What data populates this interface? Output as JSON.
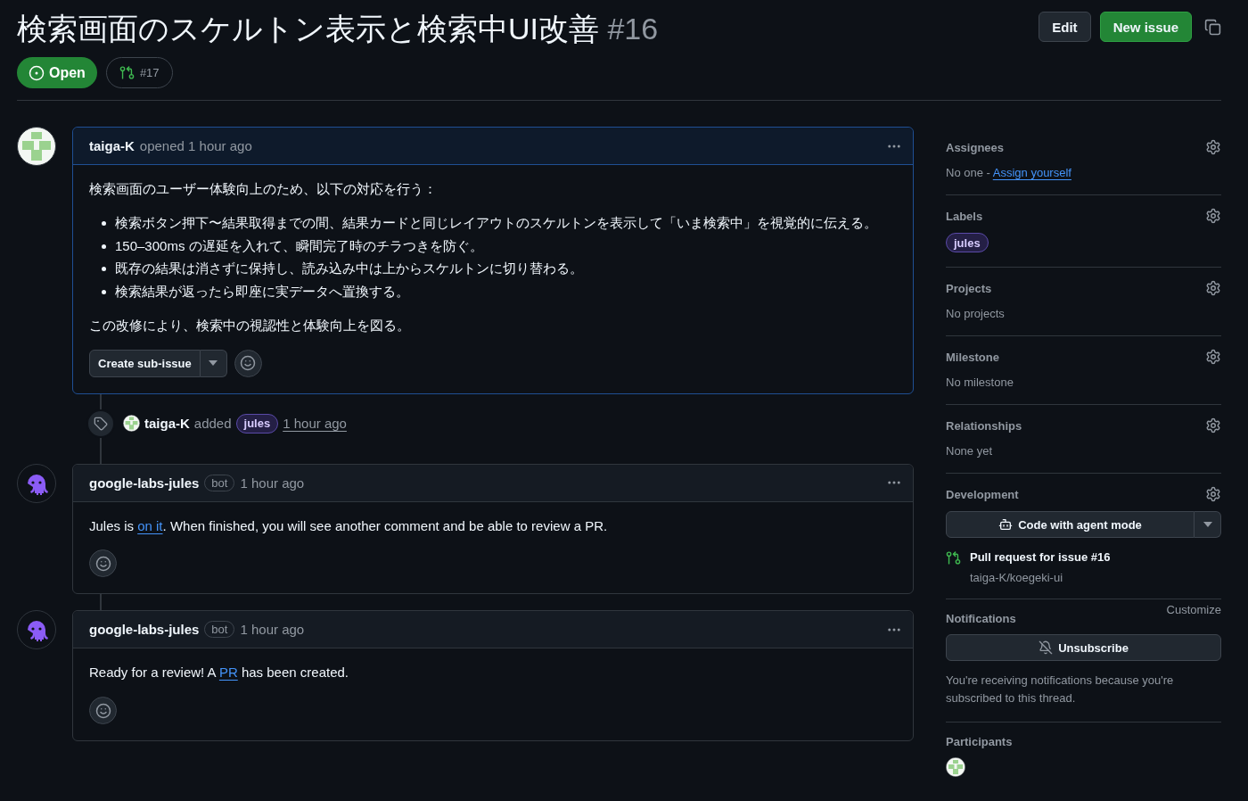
{
  "header": {
    "title": "検索画面のスケルトン表示と検索中UI改善",
    "number": "#16",
    "state": {
      "label": "Open",
      "kind": "open"
    },
    "linked_pr": "#17",
    "actions": [
      {
        "label": "Edit",
        "kind": "default"
      },
      {
        "label": "New issue",
        "kind": "primary"
      }
    ]
  },
  "timeline": [
    {
      "kind": "comment",
      "highlighted": true,
      "avatar": {
        "kind": "identicon"
      },
      "author": "taiga-K",
      "meta": "opened 1 hour ago",
      "body": [
        {
          "kind": "paragraph",
          "segments": [
            {
              "text": "検索画面のユーザー体験向上のため、以下の対応を行う："
            }
          ]
        },
        {
          "kind": "list",
          "items": [
            "検索ボタン押下〜結果取得までの間、結果カードと同じレイアウトのスケルトンを表示して「いま検索中」を視覚的に伝える。",
            "150–300ms の遅延を入れて、瞬間完了時のチラつきを防ぐ。",
            "既存の結果は消さずに保持し、読み込み中は上からスケルトンに切り替わる。",
            "検索結果が返ったら即座に実データへ置換する。"
          ]
        },
        {
          "kind": "paragraph",
          "segments": [
            {
              "text": "この改修により、検索中の視認性と体験向上を図る。"
            }
          ]
        }
      ],
      "footer_button": "Create sub-issue"
    },
    {
      "kind": "event",
      "avatar": {
        "kind": "identicon"
      },
      "actor": "taiga-K",
      "action": "added",
      "label": "jules",
      "time": "1 hour ago"
    },
    {
      "kind": "comment",
      "highlighted": false,
      "avatar": {
        "kind": "octopus"
      },
      "author": "google-labs-jules",
      "badge": "bot",
      "meta": "1 hour ago",
      "body": [
        {
          "kind": "paragraph",
          "segments": [
            {
              "text": "Jules is "
            },
            {
              "link": "on it"
            },
            {
              "text": ". When finished, you will see another comment and be able to review a PR."
            }
          ]
        }
      ]
    },
    {
      "kind": "comment",
      "highlighted": false,
      "avatar": {
        "kind": "octopus"
      },
      "author": "google-labs-jules",
      "badge": "bot",
      "meta": "1 hour ago",
      "body": [
        {
          "kind": "paragraph",
          "segments": [
            {
              "text": "Ready for a review! A "
            },
            {
              "link": "PR"
            },
            {
              "text": " has been created."
            }
          ]
        }
      ]
    }
  ],
  "sidebar": [
    {
      "kind": "text",
      "title": "Assignees",
      "settings": true,
      "segments": [
        {
          "text": "No one - "
        },
        {
          "link": "Assign yourself"
        }
      ]
    },
    {
      "kind": "labels",
      "title": "Labels",
      "settings": true,
      "labels": [
        "jules"
      ]
    },
    {
      "kind": "text",
      "title": "Projects",
      "settings": true,
      "segments": [
        {
          "text": "No projects"
        }
      ]
    },
    {
      "kind": "text",
      "title": "Milestone",
      "settings": true,
      "segments": [
        {
          "text": "No milestone"
        }
      ]
    },
    {
      "kind": "text",
      "title": "Relationships",
      "settings": true,
      "segments": [
        {
          "text": "None yet"
        }
      ]
    },
    {
      "kind": "development",
      "title": "Development",
      "settings": true,
      "button": "Code with agent mode",
      "pr": {
        "title": "Pull request for issue #16",
        "repo": "taiga-K/koegeki-ui"
      }
    },
    {
      "kind": "notifications",
      "title": "Notifications",
      "settings": false,
      "link": "Customize",
      "button": "Unsubscribe",
      "note": "You're receiving notifications because you're subscribed to this thread."
    },
    {
      "kind": "participants",
      "title": "Participants",
      "settings": false,
      "avatars": [
        {
          "kind": "identicon"
        }
      ]
    }
  ]
}
